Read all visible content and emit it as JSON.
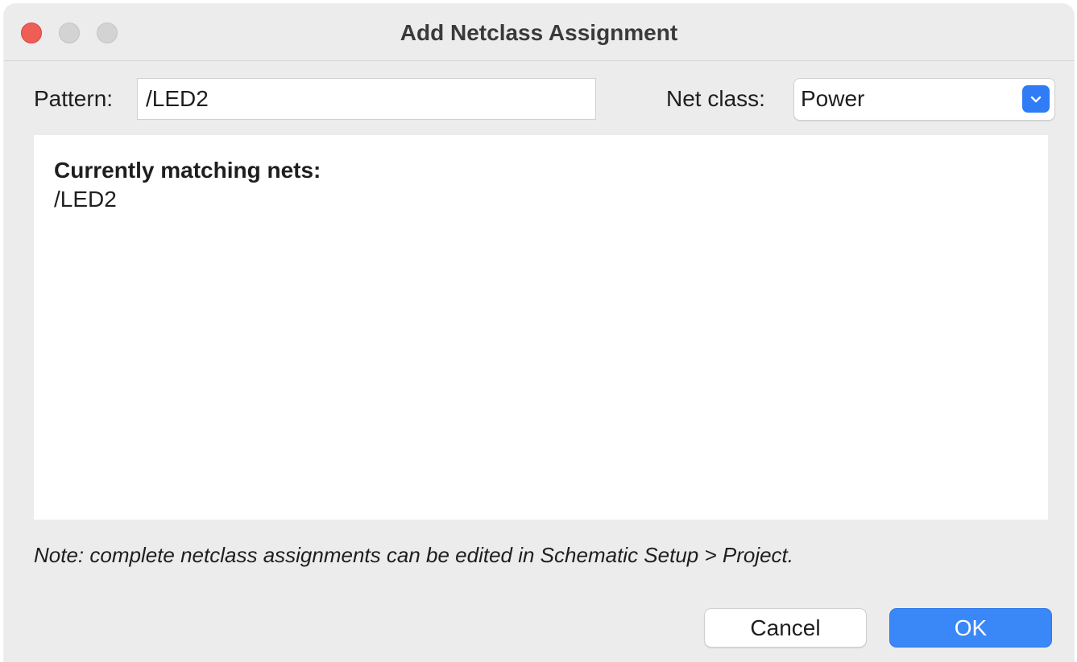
{
  "window": {
    "title": "Add Netclass Assignment"
  },
  "pattern": {
    "label": "Pattern:",
    "value": "/LED2"
  },
  "netclass": {
    "label": "Net class:",
    "selected": "Power"
  },
  "matches": {
    "heading": "Currently matching nets:",
    "nets": [
      "/LED2"
    ]
  },
  "note": "Note: complete netclass assignments can be edited in Schematic Setup > Project.",
  "buttons": {
    "cancel": "Cancel",
    "ok": "OK"
  },
  "colors": {
    "accent": "#3a87f7",
    "close": "#ee5e57",
    "background": "#ececec"
  },
  "icons": {
    "dropdown": "chevron-down-icon"
  }
}
